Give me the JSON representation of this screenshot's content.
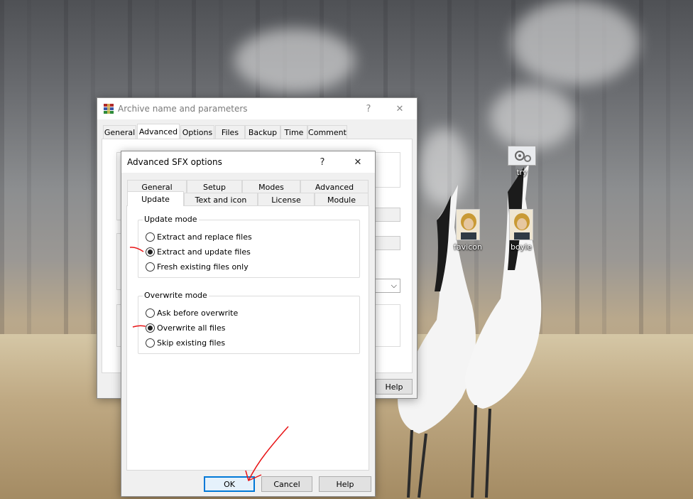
{
  "desktop": {
    "icons": [
      {
        "label": "try",
        "icon": "gear-shortcut-icon"
      },
      {
        "label": "favicon",
        "icon": "portrait-image-icon"
      },
      {
        "label": "boyle",
        "icon": "portrait-image-icon"
      }
    ]
  },
  "back_window": {
    "title": "Archive name and parameters",
    "help_glyph": "?",
    "close_glyph": "✕",
    "tabs": [
      "General",
      "Advanced",
      "Options",
      "Files",
      "Backup",
      "Time",
      "Comment"
    ],
    "active_tab": "Advanced",
    "help_button": "Help",
    "dropdown_arrow": "⌵"
  },
  "sfx_dialog": {
    "title": "Advanced SFX options",
    "help_glyph": "?",
    "close_glyph": "✕",
    "tabs_row1": [
      "General",
      "Setup",
      "Modes",
      "Advanced"
    ],
    "tabs_row2": [
      "Update",
      "Text and icon",
      "License",
      "Module"
    ],
    "active_tab": "Update",
    "update_mode": {
      "label": "Update mode",
      "options": [
        "Extract and replace files",
        "Extract and update files",
        "Fresh existing files only"
      ],
      "selected": "Extract and update files"
    },
    "overwrite_mode": {
      "label": "Overwrite mode",
      "options": [
        "Ask before overwrite",
        "Overwrite all files",
        "Skip existing files"
      ],
      "selected": "Overwrite all files"
    },
    "buttons": {
      "ok": "OK",
      "cancel": "Cancel",
      "help": "Help"
    }
  },
  "colors": {
    "accent": "#0078d7",
    "annotation": "#e81416"
  }
}
